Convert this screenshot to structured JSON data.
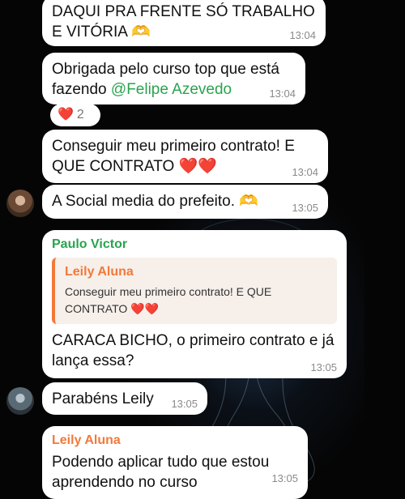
{
  "messages": [
    {
      "text": "DAQUI PRA FRENTE SÓ TRABALHO E VITÓRIA",
      "emoji": "🫶",
      "time": "13:04"
    },
    {
      "text_before": "Obrigada pelo curso top que está fazendo ",
      "mention": "@Felipe Azevedo",
      "time": "13:04",
      "reaction": {
        "emoji": "❤️",
        "count": "2"
      }
    },
    {
      "text": "Conseguir meu primeiro contrato! E QUE CONTRATO",
      "emoji": "❤️❤️",
      "time": "13:04"
    },
    {
      "text": "A Social media do prefeito.",
      "emoji": "🫶",
      "time": "13:05"
    },
    {
      "sender": "Paulo Victor",
      "sender_color": "#2aa34e",
      "reply": {
        "name": "Leily Aluna",
        "text": "Conseguir meu primeiro contrato! E QUE CONTRATO",
        "emoji": "❤️❤️"
      },
      "text": "CARACA BICHO, o primeiro contrato e já lança essa?",
      "time": "13:05"
    },
    {
      "text": "Parabéns Leily",
      "time": "13:05"
    },
    {
      "sender": "Leily Aluna",
      "sender_color": "#f2793a",
      "text": "Podendo aplicar tudo que estou aprendendo no curso",
      "time": "13:05"
    }
  ],
  "colors": {
    "bubble": "#ffffff",
    "mention": "#2aa34e",
    "reply_accent": "#f2793a",
    "background": "#050505"
  }
}
